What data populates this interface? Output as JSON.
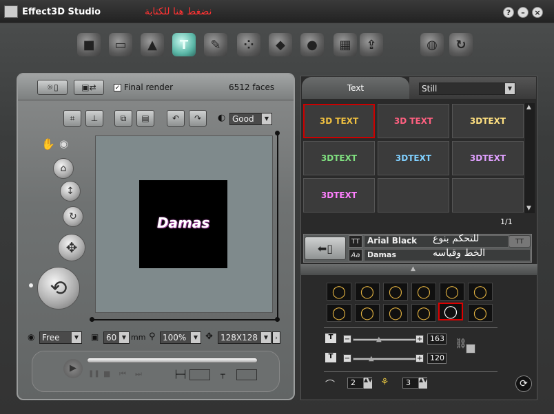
{
  "window": {
    "title": "Effect3D Studio",
    "hint": "نضغط هنا للكتابة",
    "buttons": [
      "?",
      "–",
      "×"
    ]
  },
  "toolbar": {
    "tools": [
      "box-icon",
      "panel-icon",
      "shapes-icon",
      "text-3d-icon",
      "brush-icon",
      "dots-icon",
      "paint-bucket-icon",
      "bulb-icon",
      "texture-icon",
      "export-icon",
      "web-icon",
      "refresh-icon"
    ],
    "active": "text-3d-icon"
  },
  "left": {
    "final_render_label": "Final render",
    "final_render_checked": true,
    "faces": "6512 faces",
    "quality": "Good",
    "preview_text": "Damas",
    "camera_mode": "Free",
    "focal": "60",
    "focal_unit": "mm",
    "zoom": "100%",
    "resolution": "128X128"
  },
  "right": {
    "tab": "Text",
    "style_select": "Still",
    "thumbnails": [
      "3D TEXT",
      "3D TEXT",
      "3DTEXT",
      "3DTEXT",
      "3DTEXT",
      "3DTEXT",
      "3DTEXT",
      "",
      ""
    ],
    "page": "1/1",
    "font_name": "Arial Black",
    "font_note": "للتحكم بنوع",
    "text_value": "Damas",
    "text_note": "الخط وقياسه",
    "width_value": "163",
    "height_value": "120",
    "bevel1_value": "2",
    "bevel2_value": "3"
  },
  "colors": {
    "accent": "#5bb7a7",
    "hint_red": "#ff3333",
    "selected_border": "#cc0000"
  }
}
